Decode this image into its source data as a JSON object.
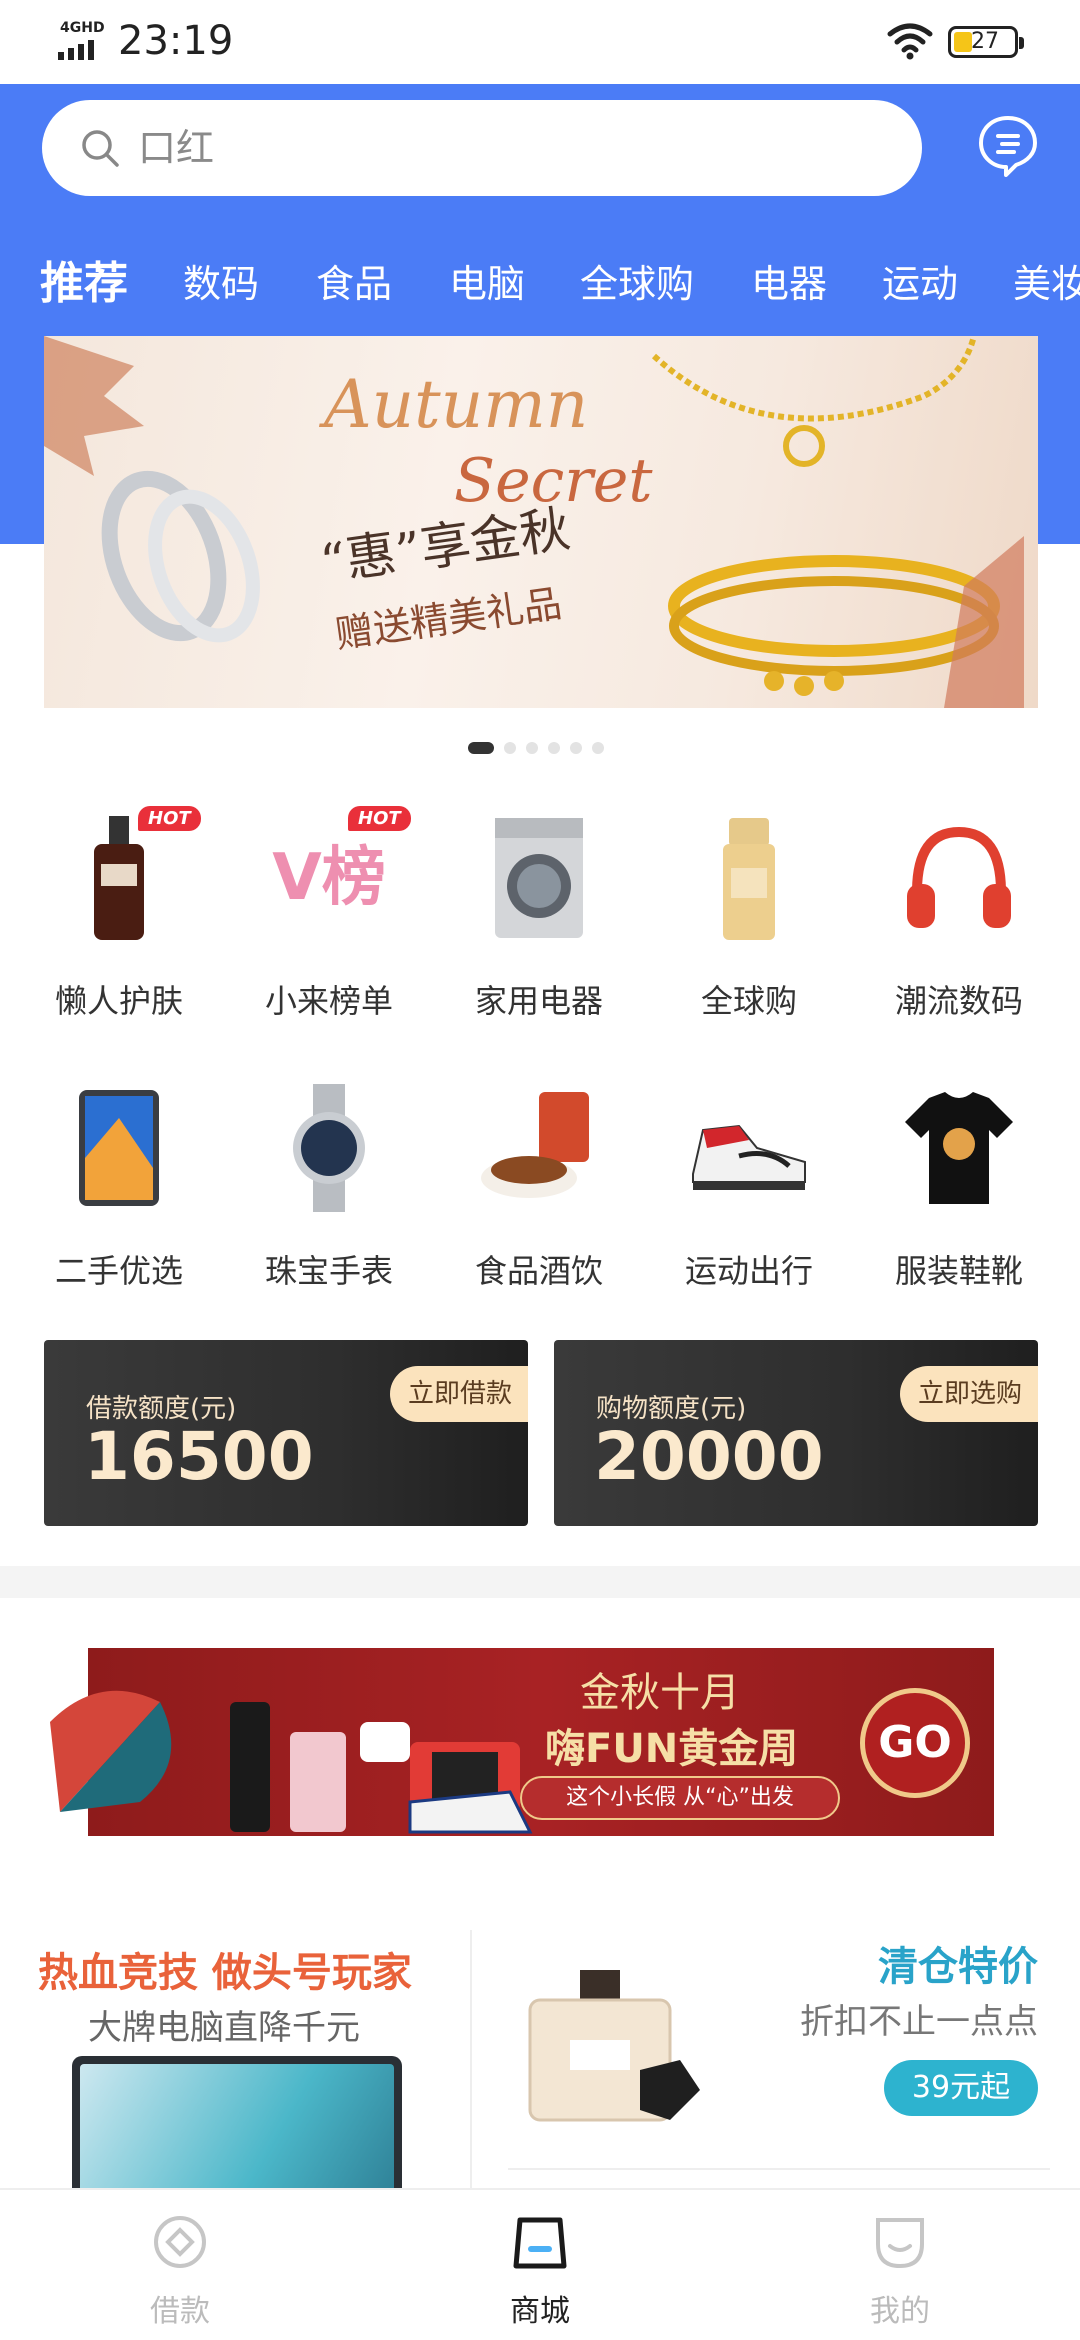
{
  "status_bar": {
    "network": "4GHD",
    "time": "23:19",
    "battery": "27"
  },
  "search": {
    "placeholder": "口红"
  },
  "category_tabs": [
    "推荐",
    "数码",
    "食品",
    "电脑",
    "全球购",
    "电器",
    "运动",
    "美妆"
  ],
  "banner": {
    "line1": "Autumn",
    "line2": "Secret",
    "line3": "“惠”享金秋",
    "line4": "赠送精美礼品"
  },
  "carousel": {
    "count": 6,
    "active": 0
  },
  "grid": [
    {
      "label": "懒人护肤",
      "hot": "HOT",
      "icon": "serum-bottle-icon"
    },
    {
      "label": "小来榜单",
      "hot": "HOT",
      "icon": "v-ranking-icon",
      "icon_text": "V榜"
    },
    {
      "label": "家用电器",
      "hot": "",
      "icon": "washing-machine-icon"
    },
    {
      "label": "全球购",
      "hot": "",
      "icon": "sunscreen-icon"
    },
    {
      "label": "潮流数码",
      "hot": "",
      "icon": "headphones-icon"
    },
    {
      "label": "二手优选",
      "hot": "",
      "icon": "tablet-icon"
    },
    {
      "label": "珠宝手表",
      "hot": "",
      "icon": "watch-icon"
    },
    {
      "label": "食品酒饮",
      "hot": "",
      "icon": "snacks-icon"
    },
    {
      "label": "运动出行",
      "hot": "",
      "icon": "sneaker-icon"
    },
    {
      "label": "服装鞋靴",
      "hot": "",
      "icon": "tshirt-icon"
    }
  ],
  "credit": {
    "loan": {
      "caption": "借款额度(元)",
      "amount": "16500",
      "action": "立即借款"
    },
    "shop": {
      "caption": "购物额度(元)",
      "amount": "20000",
      "action": "立即选购"
    }
  },
  "promo": {
    "title1": "金秋十月",
    "title2": "嗨FUN黄金周",
    "tagline": "这个小长假 从“心”出发",
    "cta": "GO"
  },
  "tiles": {
    "left": {
      "title": "热血竞技 做头号玩家",
      "subtitle": "大牌电脑直降千元"
    },
    "right": {
      "title": "清仓特价",
      "subtitle": "折扣不止一点点",
      "price": "39元起"
    }
  },
  "bottom_nav": [
    {
      "label": "借款",
      "icon": "loan-icon",
      "active": false
    },
    {
      "label": "商城",
      "icon": "mall-icon",
      "active": true
    },
    {
      "label": "我的",
      "icon": "profile-icon",
      "active": false
    }
  ],
  "colors": {
    "brand_blue": "#4b7cf6",
    "hot_red": "#e9303a",
    "accent_gold": "#fbe3bd"
  }
}
